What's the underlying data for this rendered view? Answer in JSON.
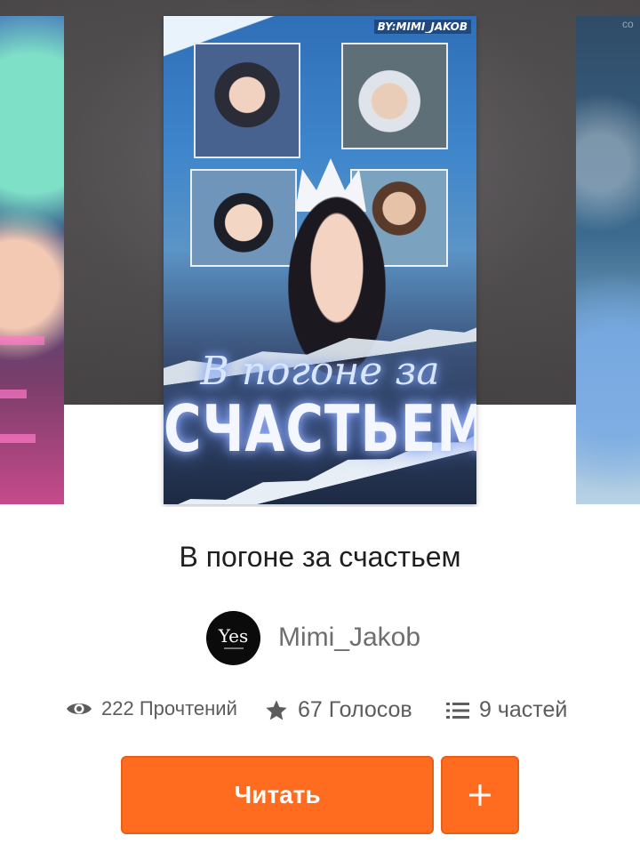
{
  "cover": {
    "byline": "BY:MIMI_JAKOB",
    "title_line1": "В погоне за",
    "title_line2": "СЧАСТЬЕМ",
    "side_right_corner": "co"
  },
  "story": {
    "title": "В погоне за счастьем",
    "author": {
      "name": "Mimi_Jakob",
      "avatar_text": "Yes"
    }
  },
  "stats": {
    "reads": "222 Прочтений",
    "votes": "67 Голосов",
    "parts": "9 частей"
  },
  "actions": {
    "read_label": "Читать",
    "add_label": "+"
  },
  "colors": {
    "accent": "#ff6b1f",
    "text_primary": "#1f1f1f",
    "text_secondary": "#5c5c5c"
  },
  "icons": {
    "reads": "eye-icon",
    "votes": "star-icon",
    "parts": "list-icon",
    "add": "plus-icon"
  }
}
